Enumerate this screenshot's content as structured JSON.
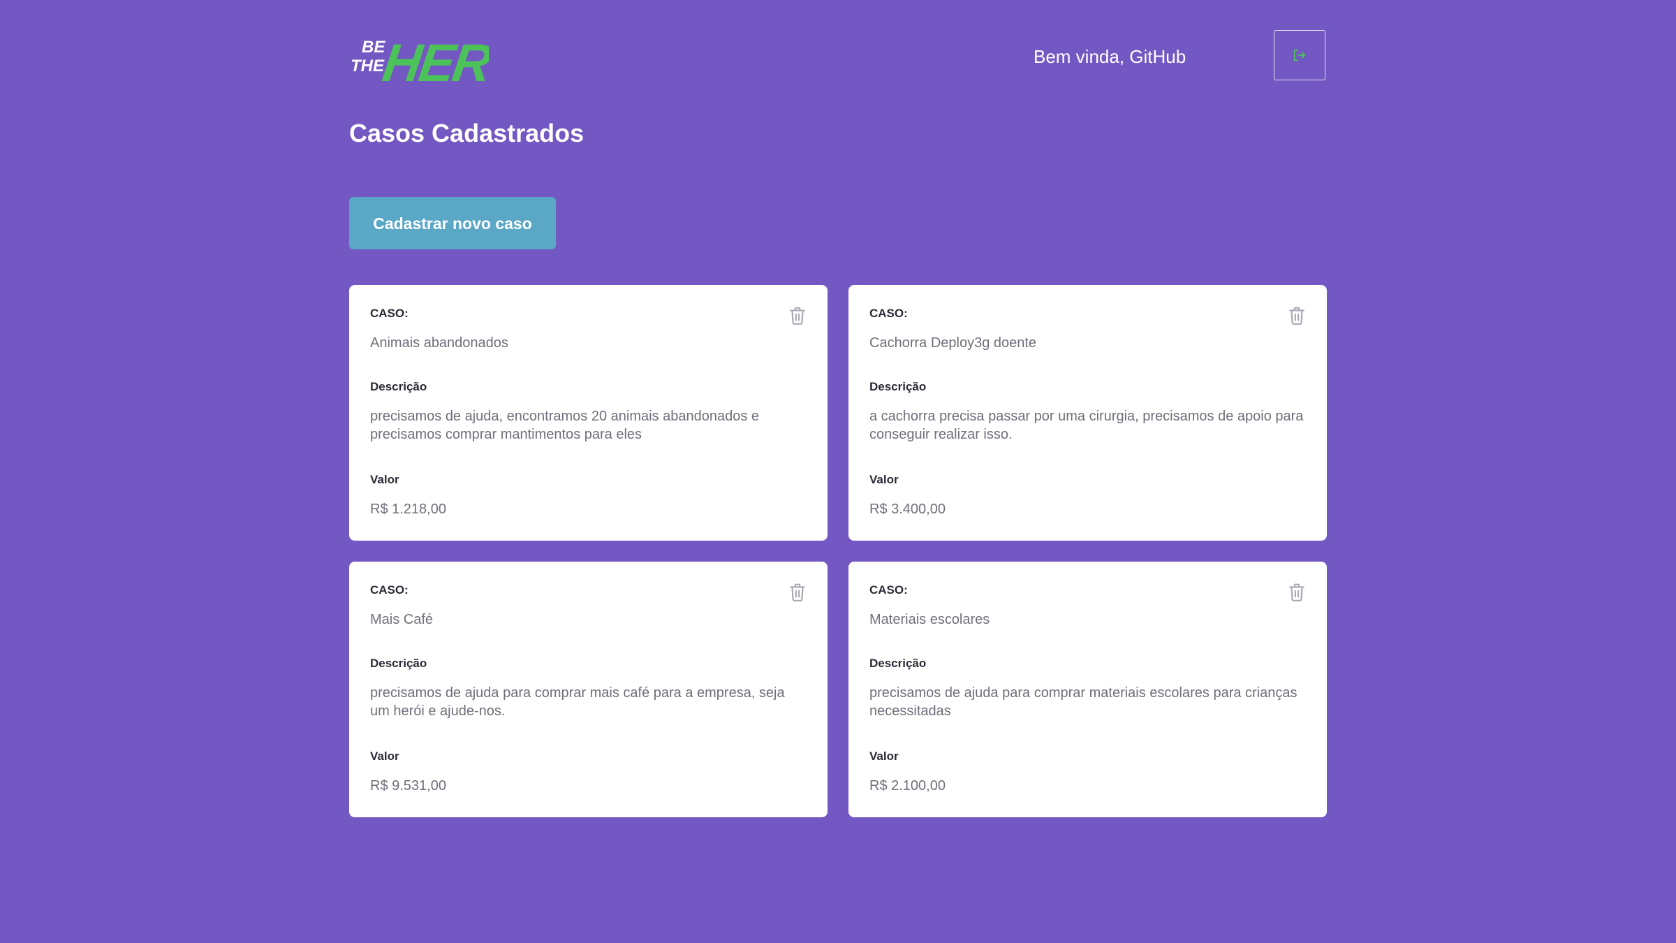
{
  "header": {
    "logo": {
      "text_be": "BE",
      "text_the": "THE",
      "text_hero": "HERO"
    },
    "welcome": "Bem vinda, GitHub",
    "logout_icon": "power-logout-icon"
  },
  "page_title": "Casos Cadastrados",
  "new_case_label": "Cadastrar novo caso",
  "labels": {
    "case": "CASO:",
    "description": "Descrição",
    "value": "Valor"
  },
  "cases": [
    {
      "title": "Animais abandonados",
      "description": "precisamos de ajuda, encontramos 20 animais abandonados e precisamos comprar mantimentos para eles",
      "value": "R$ 1.218,00"
    },
    {
      "title": "Cachorra Deploy3g doente",
      "description": "a cachorra precisa passar por uma cirurgia, precisamos de apoio para conseguir realizar isso.",
      "value": "R$ 3.400,00"
    },
    {
      "title": "Mais Café",
      "description": "precisamos de ajuda para comprar mais café para a empresa, seja um herói e ajude-nos.",
      "value": "R$ 9.531,00"
    },
    {
      "title": "Materiais escolares",
      "description": "precisamos de ajuda para comprar materiais escolares para crianças necessitadas",
      "value": "R$ 2.100,00"
    }
  ],
  "colors": {
    "background": "#7357c2",
    "accent_green": "#4cc35a",
    "button_blue": "#5aa7c6",
    "card_bg": "#ffffff",
    "text_dark": "#2a2a35",
    "text_muted": "#6f6f7b"
  }
}
